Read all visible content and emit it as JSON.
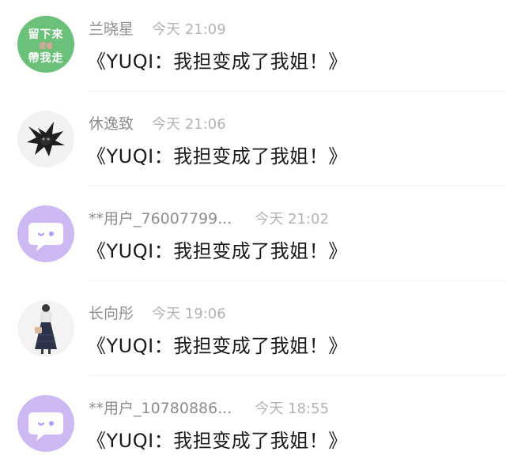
{
  "comments": [
    {
      "avatar": {
        "type": "text-badge",
        "lines": [
          "留下來",
          "或者",
          "帶我走"
        ],
        "bg": "#6bc07a"
      },
      "username": "兰晓星",
      "time": "今天 21:09",
      "content": "《YUQI：我担变成了我姐！》"
    },
    {
      "avatar": {
        "type": "dark-creature-icon"
      },
      "username": "休逸致",
      "time": "今天 21:06",
      "content": "《YUQI：我担变成了我姐！》"
    },
    {
      "avatar": {
        "type": "default-chat-face-icon",
        "bg": "#c8b3f0"
      },
      "username": "**用户_76007799...",
      "time": "今天 21:02",
      "content": "《YUQI：我担变成了我姐！》"
    },
    {
      "avatar": {
        "type": "doll-dress-icon"
      },
      "username": "长向彤",
      "time": "今天 19:06",
      "content": "《YUQI：我担变成了我姐！》"
    },
    {
      "avatar": {
        "type": "default-chat-face-icon",
        "bg": "#c8b3f0"
      },
      "username": "**用户_10780886...",
      "time": "今天 18:55",
      "content": "《YUQI：我担变成了我姐！》"
    }
  ]
}
